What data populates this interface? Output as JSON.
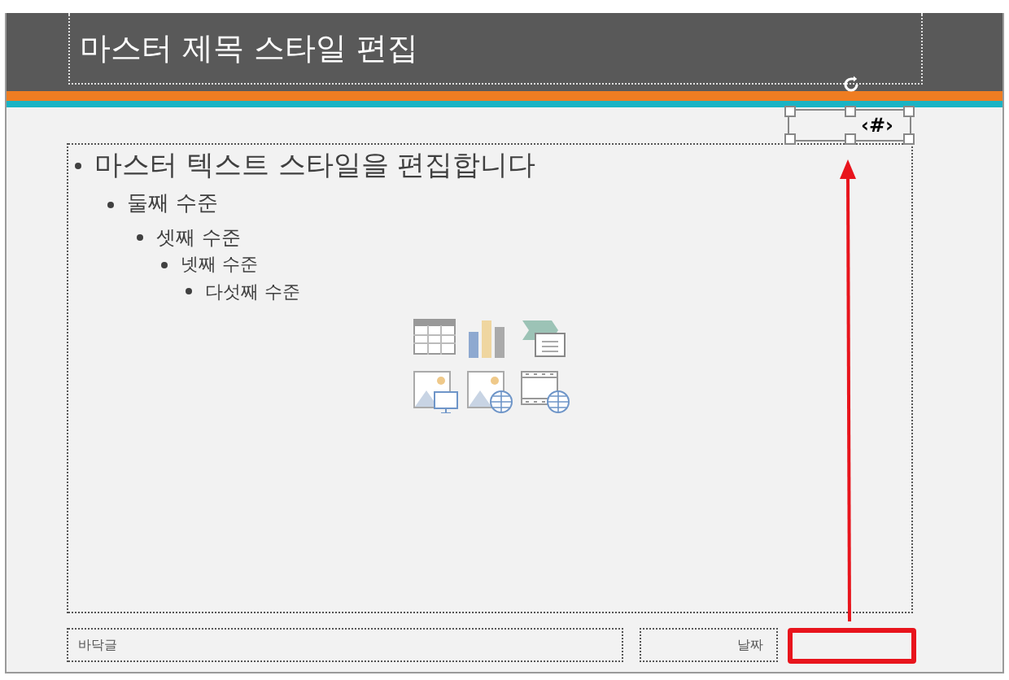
{
  "title_placeholder": {
    "text": "마스터 제목 스타일 편집"
  },
  "page_number_placeholder": {
    "text": "‹#›",
    "selected": true
  },
  "body_placeholder": {
    "items": [
      {
        "text": "마스터 텍스트 스타일을 편집합니다",
        "children": [
          {
            "text": "둘째 수준",
            "children": [
              {
                "text": "셋째 수준",
                "children": [
                  {
                    "text": "넷째 수준",
                    "children": [
                      {
                        "text": "다섯째 수준"
                      }
                    ]
                  }
                ]
              }
            ]
          }
        ]
      }
    ]
  },
  "footer_placeholder": {
    "text": "바닥글"
  },
  "date_placeholder": {
    "text": "날짜"
  }
}
